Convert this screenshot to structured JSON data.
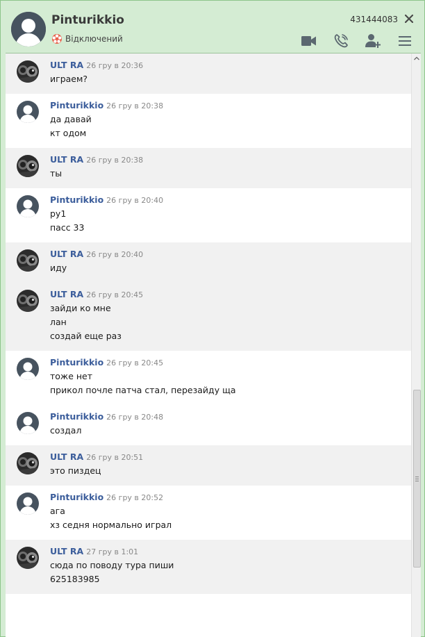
{
  "header": {
    "contact_name": "Pinturikkio",
    "status_text": "Відключений",
    "contact_id": "431444083",
    "close_glyph": "✕",
    "toolbar_icons": [
      "video-call-icon",
      "voice-call-icon",
      "add-contact-icon",
      "menu-icon"
    ],
    "status_icon": "offline-status-icon"
  },
  "colors": {
    "frame": "#d4ecd3",
    "author": "#3b5d9b",
    "time": "#888888",
    "row_alt": "#f1f1f1"
  },
  "messages": [
    {
      "author": "ULT RA",
      "avatar": "ultra",
      "time": "26 гру в 20:36",
      "lines": [
        "играем?"
      ]
    },
    {
      "author": "Pinturikkio",
      "avatar": "default",
      "time": "26 гру в 20:38",
      "lines": [
        "да давай",
        "кт одом"
      ]
    },
    {
      "author": "ULT RA",
      "avatar": "ultra",
      "time": "26 гру в 20:38",
      "lines": [
        "ты"
      ]
    },
    {
      "author": "Pinturikkio",
      "avatar": "default",
      "time": "26 гру в 20:40",
      "lines": [
        "ру1",
        "пасс 33"
      ]
    },
    {
      "author": "ULT RA",
      "avatar": "ultra",
      "time": "26 гру в 20:40",
      "lines": [
        "иду"
      ]
    },
    {
      "author": "ULT RA",
      "avatar": "ultra",
      "time": "26 гру в 20:45",
      "lines": [
        "зайди ко мне",
        "лан",
        "создай еще раз"
      ]
    },
    {
      "author": "Pinturikkio",
      "avatar": "default",
      "time": "26 гру в 20:45",
      "lines": [
        "тоже нет",
        "прикол почле патча стал, перезайду ща"
      ]
    },
    {
      "author": "Pinturikkio",
      "avatar": "default",
      "time": "26 гру в 20:48",
      "lines": [
        "создал"
      ]
    },
    {
      "author": "ULT RA",
      "avatar": "ultra",
      "time": "26 гру в 20:51",
      "lines": [
        "это пиздец"
      ]
    },
    {
      "author": "Pinturikkio",
      "avatar": "default",
      "time": "26 гру в 20:52",
      "lines": [
        "ага",
        "хз седня нормально играл"
      ]
    },
    {
      "author": "ULT RA",
      "avatar": "ultra",
      "time": "27 гру в 1:01",
      "lines": [
        "сюда по поводу тура пиши",
        "625183985"
      ]
    }
  ]
}
